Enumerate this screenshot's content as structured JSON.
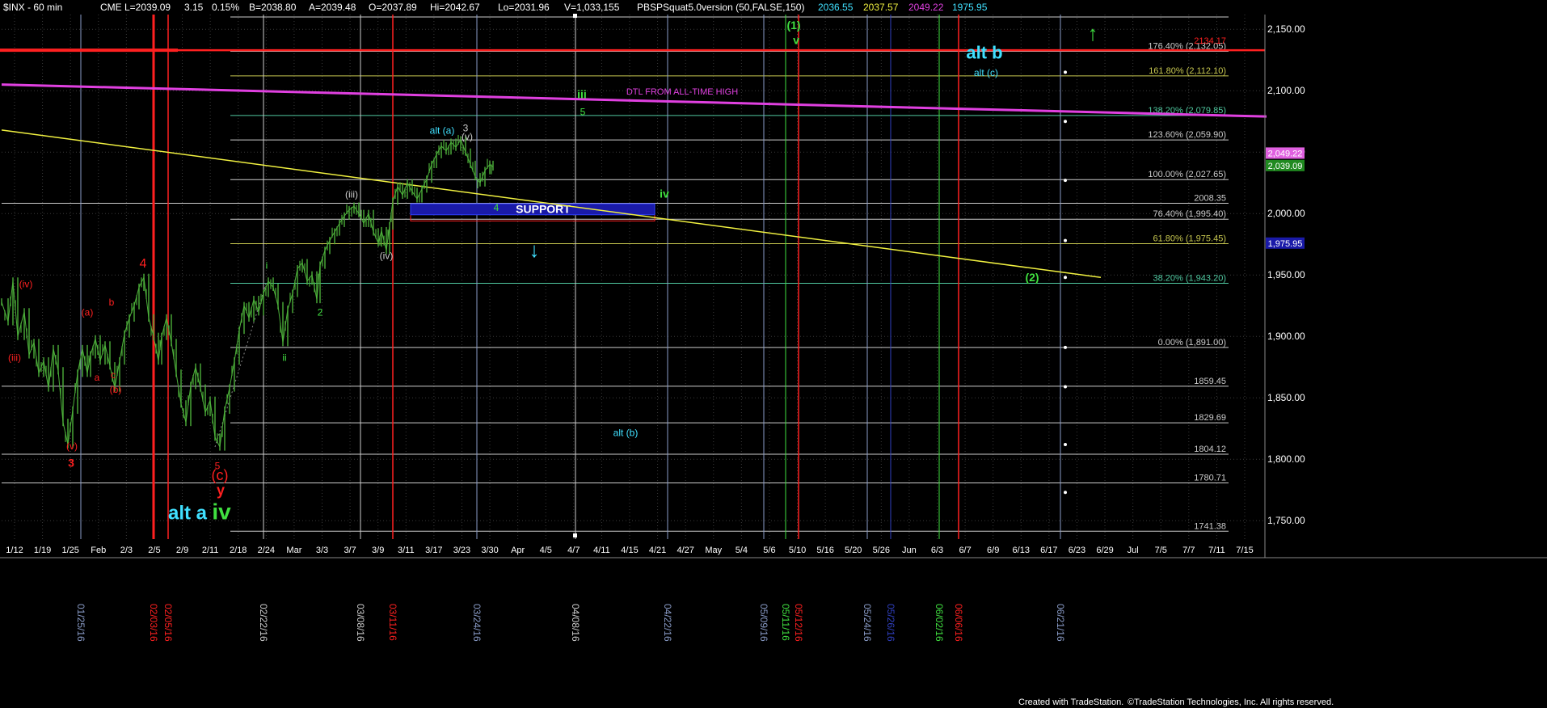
{
  "header": {
    "symbol": "$INX - 60 min",
    "exchange": "CME",
    "last": "L=2039.09",
    "change": "3.15",
    "pct": "0.15%",
    "bid": "B=2038.80",
    "ask": "A=2039.48",
    "open": "O=2037.89",
    "high": "Hi=2042.67",
    "low": "Lo=2031.96",
    "volume": "V=1,033,155",
    "study": "PBSPSquat5.0version (50,FALSE,150)",
    "study_values": [
      "2036.55",
      "2037.57",
      "2049.22",
      "1975.95"
    ]
  },
  "footer": {
    "left": "Created with TradeStation.",
    "right": "©TradeStation Technologies, Inc. All rights reserved."
  },
  "colors": {
    "background": "#000000",
    "price": "#4caf3a",
    "red": "#ff2020",
    "magenta": "#e040e0",
    "yellow": "#f0f040",
    "cyan": "#40e0ff",
    "green": "#40e040",
    "support_fill": "#1a1aa8",
    "last_price_tag": "#208a20",
    "fib_tag": "#e060e0"
  },
  "chart_data": {
    "type": "line",
    "ylim": [
      1735,
      2162
    ],
    "x_tick_labels": [
      "1/12",
      "1/19",
      "1/25",
      "Feb",
      "2/3",
      "2/5",
      "2/9",
      "2/11",
      "2/18",
      "2/24",
      "Mar",
      "3/3",
      "3/7",
      "3/9",
      "3/11",
      "3/17",
      "3/23",
      "3/30",
      "Apr",
      "4/5",
      "4/7",
      "4/11",
      "4/15",
      "4/21",
      "4/27",
      "May",
      "5/4",
      "5/6",
      "5/10",
      "5/16",
      "5/20",
      "5/26",
      "Jun",
      "6/3",
      "6/7",
      "6/9",
      "6/13",
      "6/17",
      "6/23",
      "6/29",
      "Jul",
      "7/5",
      "7/7",
      "7/11",
      "7/15"
    ],
    "y_tick_labels": [
      "2,150.00",
      "2,100.00",
      "2,050.00",
      "2,000.00",
      "1,950.00",
      "1,900.00",
      "1,850.00",
      "1,800.00",
      "1,750.00"
    ],
    "y_tick_values": [
      2150,
      2100,
      2050,
      2000,
      1950,
      1900,
      1850,
      1800,
      1750
    ],
    "fib_levels": [
      {
        "label": "176.40% (2,132.05)",
        "value": 2132.05,
        "color": "#cccccc"
      },
      {
        "label": "161.80% (2,112.10)",
        "value": 2112.1,
        "color": "#c8c850"
      },
      {
        "label": "138.20% (2,079.85)",
        "value": 2079.85,
        "color": "#50c8a0"
      },
      {
        "label": "123.60% (2,059.90)",
        "value": 2059.9,
        "color": "#cccccc"
      },
      {
        "label": "100.00% (2,027.65)",
        "value": 2027.65,
        "color": "#cccccc"
      },
      {
        "label": "2008.35",
        "value": 2008.35,
        "color": "#cccccc"
      },
      {
        "label": "76.40% (1,995.40)",
        "value": 1995.4,
        "color": "#cccccc"
      },
      {
        "label": "61.80% (1,975.45)",
        "value": 1975.45,
        "color": "#c8c850"
      },
      {
        "label": "38.20% (1,943.20)",
        "value": 1943.2,
        "color": "#50c8a0"
      },
      {
        "label": "0.00% (1,891.00)",
        "value": 1891.0,
        "color": "#cccccc"
      },
      {
        "label": "1859.45",
        "value": 1859.45,
        "color": "#cccccc"
      },
      {
        "label": "1829.69",
        "value": 1829.69,
        "color": "#cccccc"
      },
      {
        "label": "1804.12",
        "value": 1804.12,
        "color": "#cccccc"
      },
      {
        "label": "1780.71",
        "value": 1780.71,
        "color": "#cccccc"
      },
      {
        "label": "1741.38",
        "value": 1741.38,
        "color": "#cccccc"
      }
    ],
    "price_tags": [
      {
        "label": "2,049.22",
        "value": 2049.22,
        "color": "#e060e0"
      },
      {
        "label": "2,039.09",
        "value": 2039.09,
        "color": "#208a20"
      },
      {
        "label": "1,975.95",
        "value": 1975.95,
        "color": "#1a1aa8"
      }
    ],
    "top_label": "2134.17",
    "red_hline": 2133,
    "top_fib_partial": 2164,
    "date_markers": [
      {
        "label": "01/25/16",
        "color": "#8a9cc8"
      },
      {
        "label": "02/03/16",
        "color": "#ff2020"
      },
      {
        "label": "02/05/16",
        "color": "#ff2020"
      },
      {
        "label": "02/22/16",
        "color": "#cccccc"
      },
      {
        "label": "03/08/16",
        "color": "#cccccc"
      },
      {
        "label": "03/11/16",
        "color": "#ff2020"
      },
      {
        "label": "03/24/16",
        "color": "#8a9cc8"
      },
      {
        "label": "04/08/16",
        "color": "#cccccc"
      },
      {
        "label": "04/22/16",
        "color": "#8a9cc8"
      },
      {
        "label": "05/09/16",
        "color": "#8a9cc8"
      },
      {
        "label": "05/11/16",
        "color": "#40e040"
      },
      {
        "label": "05/12/16",
        "color": "#ff2020"
      },
      {
        "label": "05/24/16",
        "color": "#8a9cc8"
      },
      {
        "label": "05/26/16",
        "color": "#3040c0"
      },
      {
        "label": "06/02/16",
        "color": "#40e040"
      },
      {
        "label": "06/06/16",
        "color": "#ff2020"
      },
      {
        "label": "06/21/16",
        "color": "#8a9cc8"
      }
    ],
    "price_series": [
      [
        0,
        1928
      ],
      [
        8,
        1912
      ],
      [
        14,
        1945
      ],
      [
        20,
        1900
      ],
      [
        28,
        1920
      ],
      [
        34,
        1885
      ],
      [
        40,
        1895
      ],
      [
        46,
        1870
      ],
      [
        52,
        1880
      ],
      [
        58,
        1858
      ],
      [
        64,
        1890
      ],
      [
        70,
        1872
      ],
      [
        76,
        1830
      ],
      [
        82,
        1812
      ],
      [
        88,
        1840
      ],
      [
        94,
        1870
      ],
      [
        100,
        1890
      ],
      [
        106,
        1870
      ],
      [
        110,
        1885
      ],
      [
        116,
        1898
      ],
      [
        122,
        1880
      ],
      [
        128,
        1893
      ],
      [
        134,
        1876
      ],
      [
        140,
        1858
      ],
      [
        146,
        1880
      ],
      [
        152,
        1902
      ],
      [
        158,
        1915
      ],
      [
        164,
        1925
      ],
      [
        170,
        1940
      ],
      [
        176,
        1948
      ],
      [
        182,
        1915
      ],
      [
        188,
        1900
      ],
      [
        194,
        1880
      ],
      [
        198,
        1900
      ],
      [
        204,
        1915
      ],
      [
        210,
        1895
      ],
      [
        216,
        1870
      ],
      [
        222,
        1845
      ],
      [
        228,
        1830
      ],
      [
        234,
        1860
      ],
      [
        240,
        1875
      ],
      [
        246,
        1858
      ],
      [
        252,
        1838
      ],
      [
        258,
        1848
      ],
      [
        264,
        1818
      ],
      [
        270,
        1810
      ],
      [
        276,
        1840
      ],
      [
        282,
        1858
      ],
      [
        288,
        1880
      ],
      [
        294,
        1905
      ],
      [
        300,
        1925
      ],
      [
        306,
        1915
      ],
      [
        312,
        1930
      ],
      [
        318,
        1920
      ],
      [
        324,
        1935
      ],
      [
        330,
        1945
      ],
      [
        336,
        1940
      ],
      [
        342,
        1925
      ],
      [
        348,
        1895
      ],
      [
        354,
        1922
      ],
      [
        360,
        1935
      ],
      [
        366,
        1955
      ],
      [
        372,
        1960
      ],
      [
        378,
        1945
      ],
      [
        384,
        1950
      ],
      [
        390,
        1930
      ],
      [
        394,
        1958
      ],
      [
        400,
        1970
      ],
      [
        406,
        1978
      ],
      [
        412,
        1985
      ],
      [
        418,
        1992
      ],
      [
        424,
        1998
      ],
      [
        430,
        2003
      ],
      [
        436,
        2006
      ],
      [
        442,
        2000
      ],
      [
        448,
        1992
      ],
      [
        454,
        2000
      ],
      [
        460,
        1985
      ],
      [
        466,
        1976
      ],
      [
        470,
        1986
      ],
      [
        476,
        1970
      ],
      [
        480,
        1990
      ],
      [
        484,
        2010
      ],
      [
        490,
        2022
      ],
      [
        496,
        2015
      ],
      [
        502,
        2025
      ],
      [
        508,
        2018
      ],
      [
        514,
        2012
      ],
      [
        520,
        2020
      ],
      [
        526,
        2028
      ],
      [
        532,
        2040
      ],
      [
        538,
        2048
      ],
      [
        544,
        2055
      ],
      [
        550,
        2051
      ],
      [
        556,
        2058
      ],
      [
        562,
        2054
      ],
      [
        568,
        2060
      ],
      [
        574,
        2050
      ],
      [
        580,
        2040
      ],
      [
        586,
        2030
      ],
      [
        592,
        2025
      ],
      [
        598,
        2035
      ],
      [
        604,
        2040
      ],
      [
        608,
        2038
      ]
    ],
    "lines": {
      "magenta_dtl": {
        "label": "DTL FROM ALL-TIME HIGH",
        "from": [
          0,
          2105
        ],
        "to": [
          1565,
          2079
        ]
      },
      "yellow_trend": {
        "from": [
          0,
          2068
        ],
        "to": [
          1360,
          1948
        ]
      }
    },
    "support_box": {
      "label": "SUPPORT",
      "y1": 2008,
      "y2": 1999
    },
    "support_red_box": {
      "y1": 2003,
      "y2": 1994
    },
    "wave_labels": [
      {
        "text": "(iv)",
        "color": "#ff2020",
        "x": 30,
        "y": 1940
      },
      {
        "text": "(iii)",
        "color": "#ff2020",
        "x": 16,
        "y": 1880
      },
      {
        "text": "(a)",
        "color": "#ff2020",
        "x": 106,
        "y": 1917
      },
      {
        "text": "b",
        "color": "#ff2020",
        "x": 136,
        "y": 1925
      },
      {
        "text": "a",
        "color": "#ff2020",
        "x": 118,
        "y": 1864
      },
      {
        "text": "c",
        "color": "#ff2020",
        "x": 138,
        "y": 1866
      },
      {
        "text": "(b)",
        "color": "#ff2020",
        "x": 141,
        "y": 1854
      },
      {
        "text": "(v)",
        "color": "#ff2020",
        "x": 87,
        "y": 1808
      },
      {
        "text": "3",
        "color": "#ff2020",
        "x": 86,
        "y": 1794
      },
      {
        "text": "4",
        "color": "#ff2020",
        "x": 175,
        "y": 1956
      },
      {
        "text": "5",
        "color": "#ff2020",
        "x": 267,
        "y": 1792
      },
      {
        "text": "(c)",
        "color": "#ff2020",
        "x": 270,
        "y": 1783
      },
      {
        "text": "y",
        "color": "#ff2020",
        "x": 271,
        "y": 1771
      },
      {
        "text": "iv",
        "color": "#40e040",
        "x": 272,
        "y": 1751
      },
      {
        "text": "alt a",
        "color": "#40e0ff",
        "x": 230,
        "y": 1751
      },
      {
        "text": "i",
        "color": "#40e040",
        "x": 328,
        "y": 1955
      },
      {
        "text": "ii",
        "color": "#40e040",
        "x": 350,
        "y": 1880
      },
      {
        "text": "2",
        "color": "#40e040",
        "x": 394,
        "y": 1917
      },
      {
        "text": "(iii)",
        "color": "#cccccc",
        "x": 433,
        "y": 2013
      },
      {
        "text": "(iv)",
        "color": "#cccccc",
        "x": 476,
        "y": 1963
      },
      {
        "text": "alt (a)",
        "color": "#40e0ff",
        "x": 545,
        "y": 2065
      },
      {
        "text": "3",
        "color": "#cccccc",
        "x": 574,
        "y": 2067
      },
      {
        "text": "(v)",
        "color": "#cccccc",
        "x": 576,
        "y": 2060
      },
      {
        "text": "iii",
        "color": "#40e040",
        "x": 718,
        "y": 2094
      },
      {
        "text": "5",
        "color": "#40e040",
        "x": 719,
        "y": 2080
      },
      {
        "text": "4",
        "color": "#40e040",
        "x": 612,
        "y": 2002
      },
      {
        "text": "iv",
        "color": "#40e040",
        "x": 820,
        "y": 2013
      },
      {
        "text": "alt (b)",
        "color": "#40e0ff",
        "x": 772,
        "y": 1819
      },
      {
        "text": "(1)",
        "color": "#40e040",
        "x": 980,
        "y": 2150
      },
      {
        "text": "v",
        "color": "#40e040",
        "x": 983,
        "y": 2138
      },
      {
        "text": "alt b",
        "color": "#40e0ff",
        "x": 1216,
        "y": 2126
      },
      {
        "text": "alt (c)",
        "color": "#40e0ff",
        "x": 1218,
        "y": 2112
      },
      {
        "text": "(2)",
        "color": "#40e040",
        "x": 1275,
        "y": 1945
      }
    ]
  }
}
